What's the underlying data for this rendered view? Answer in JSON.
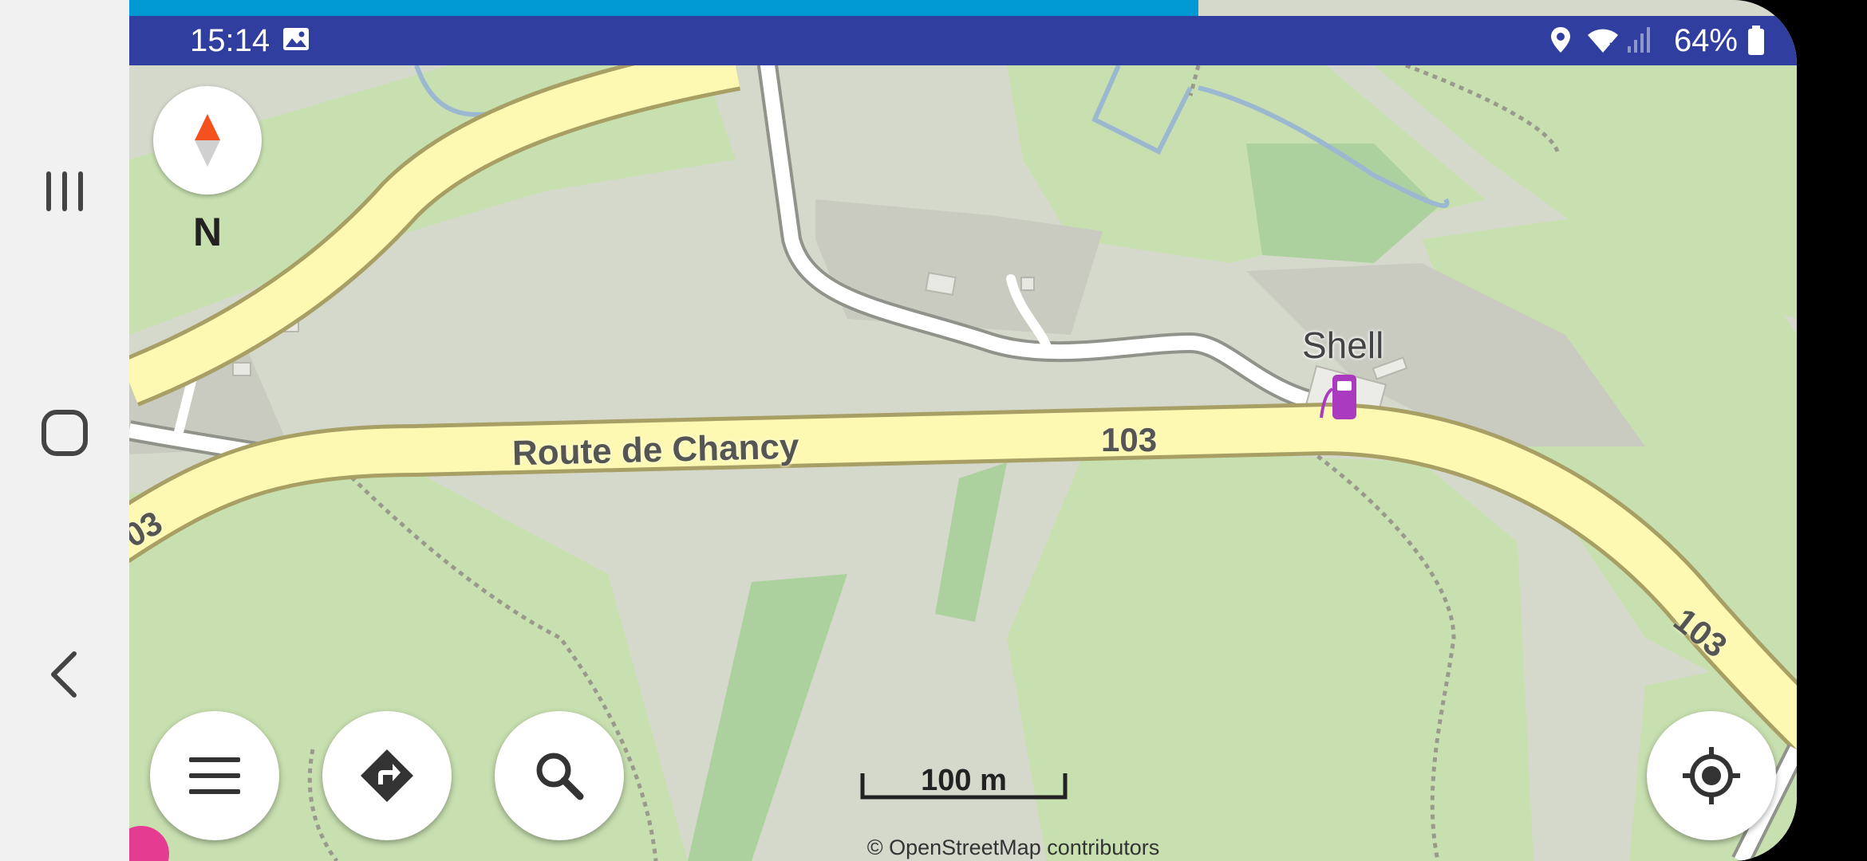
{
  "status_bar": {
    "time": "15:14",
    "battery": "64%",
    "icons": [
      "image-icon",
      "location-pin-icon",
      "wifi-icon",
      "signal-icon",
      "battery-icon"
    ]
  },
  "system_nav": {
    "items": [
      "recent-apps-icon",
      "home-icon",
      "back-icon"
    ]
  },
  "map": {
    "road_name": "Route de Chancy",
    "road_refs": [
      "103",
      "103",
      "03"
    ],
    "poi_label": "Shell",
    "poi_icon": "fuel-station-icon",
    "compass_label": "N",
    "scale_label": "100 m",
    "attribution": "© OpenStreetMap contributors"
  },
  "buttons": {
    "menu": "menu-icon",
    "directions": "directions-icon",
    "search": "search-icon",
    "my_location": "my-location-icon"
  },
  "colors": {
    "status_bar": "#303f9f",
    "progress": "#0099d4",
    "primary_road": "#fdf9b3",
    "road_casing": "#a89f64",
    "minor_road": "#ffffff",
    "grass": "#c8e0b0",
    "land": "#d5d9cc",
    "poi": "#aa3bbf"
  }
}
